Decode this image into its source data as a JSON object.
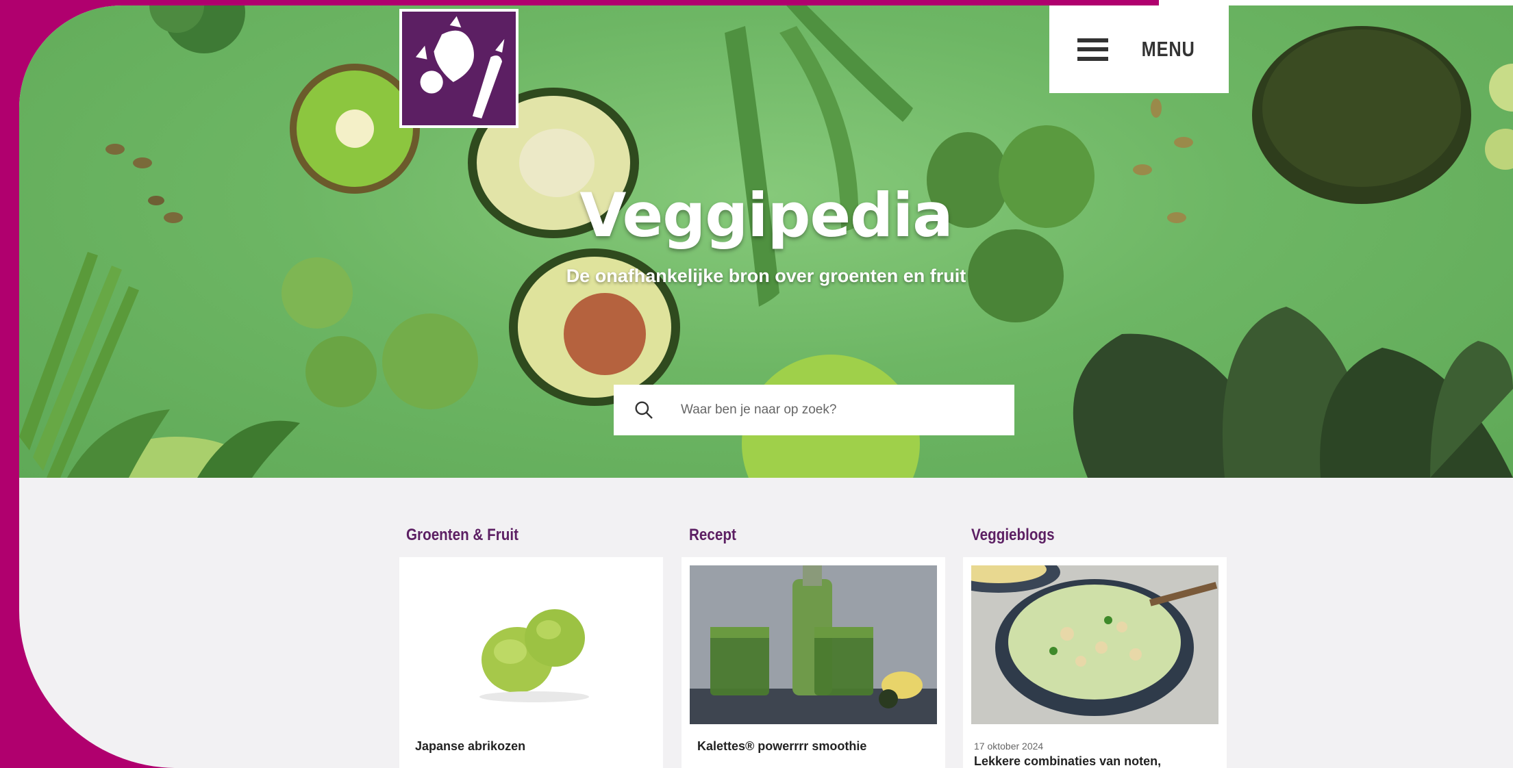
{
  "header": {
    "logo_name": "veggipedia-logo",
    "menu_label": "MENU"
  },
  "hero": {
    "title": "Veggipedia",
    "subtitle": "De onafhankelijke bron over groenten en fruit"
  },
  "search": {
    "placeholder": "Waar ben je naar op zoek?"
  },
  "categories": [
    {
      "heading": "Groenten & Fruit",
      "card_title": "Japanse abrikozen",
      "date": ""
    },
    {
      "heading": "Recept",
      "card_title": "Kalettes® powerrrr smoothie",
      "date": ""
    },
    {
      "heading": "Veggieblogs",
      "card_title": "Lekkere combinaties van noten,",
      "date": "17 oktober 2024"
    }
  ],
  "colors": {
    "brand_purple": "#5c1f63",
    "frame_magenta": "#b0006e",
    "hero_green": "#6db664"
  }
}
